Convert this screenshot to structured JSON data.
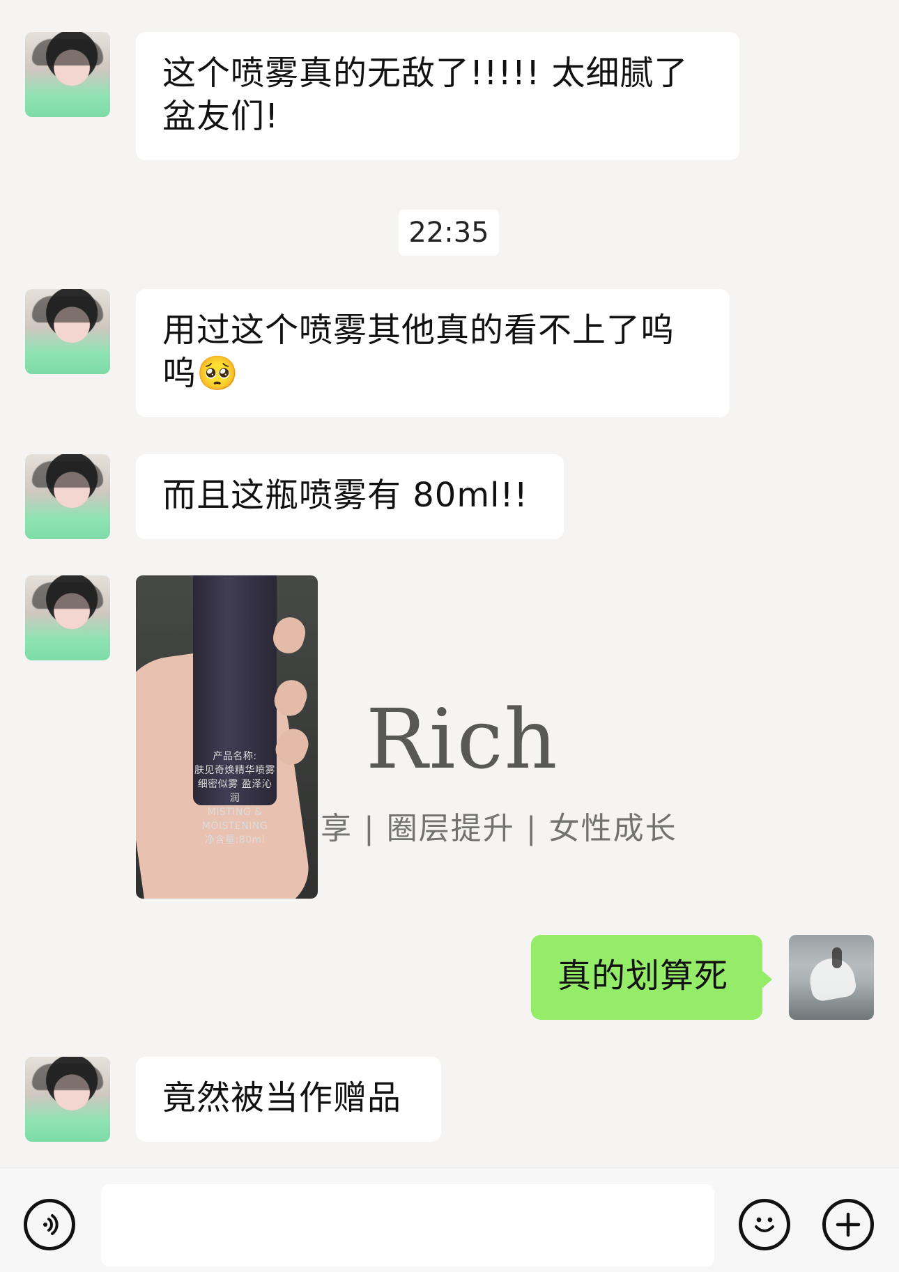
{
  "chat": {
    "messages": [
      {
        "id": "m1",
        "sender": "them",
        "type": "text",
        "text": "这个喷雾真的无敌了!!!!! 太细腻了盆友们!"
      },
      {
        "id": "time",
        "type": "timestamp",
        "text": "22:35"
      },
      {
        "id": "m2",
        "sender": "them",
        "type": "text",
        "text": "用过这个喷雾其他真的看不上了呜呜🥺"
      },
      {
        "id": "m3",
        "sender": "them",
        "type": "text",
        "text": "而且这瓶喷雾有 80ml!!"
      },
      {
        "id": "m4",
        "sender": "them",
        "type": "image",
        "image_text": "产品名称:\n肤见奇焕精华喷雾\n细密似雾 盈泽沁润\nMISTING & MOISTENING\n净含量:80ml"
      },
      {
        "id": "m5",
        "sender": "me",
        "type": "text",
        "text": "真的划算死"
      },
      {
        "id": "m6",
        "sender": "them",
        "type": "text",
        "text": "竟然被当作赠品"
      }
    ]
  },
  "watermark": {
    "brand": "Rich",
    "tagline": "享 | 圈层提升 | 女性成长"
  },
  "input_bar": {
    "voice_icon": "voice-icon",
    "emoji_icon": "emoji-icon",
    "plus_icon": "plus-icon",
    "input_value": ""
  },
  "colors": {
    "background": "#f5f4f2",
    "bubble_them": "#ffffff",
    "bubble_me": "#95ec69",
    "text": "#111111"
  }
}
